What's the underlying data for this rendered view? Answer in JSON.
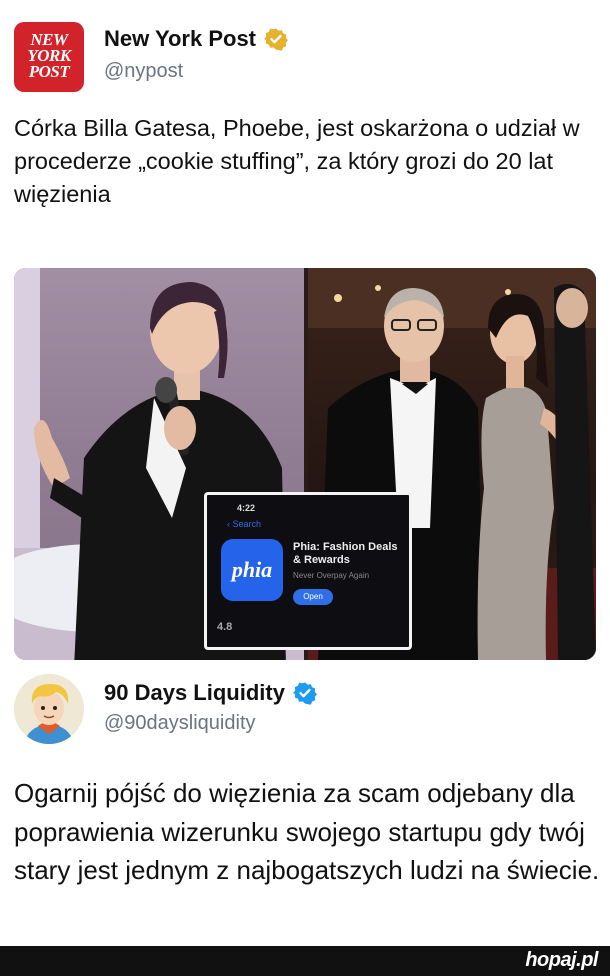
{
  "post": {
    "author_name": "New York Post",
    "author_handle": "@nypost",
    "avatar_logo": [
      "NEW",
      "YORK",
      "POST"
    ],
    "verified_badge_color": "#e6b22e",
    "text": "Córka Billa Gatesa, Phoebe, jest oskarżona o udział w procederze „cookie stuffing”, za który grozi do 20 lat więzienia",
    "image": {
      "inset_app": {
        "status_time": "4:22",
        "back_label": "Search",
        "logo_text": "phia",
        "title": "Phia: Fashion Deals & Rewards",
        "subtitle": "Never Overpay Again",
        "open_label": "Open",
        "rating": "4.8"
      }
    }
  },
  "reply": {
    "author_name": "90 Days Liquidity",
    "author_handle": "@90daysliquidity",
    "verified_badge_color": "#1d9bf0",
    "text": "Ogarnij pójść do więzienia za scam odjebany dla poprawienia wizerunku swojego startupu gdy twój stary jest jednym z najbogatszych ludzi na świecie."
  },
  "footer": {
    "brand": "hopaj.pl"
  }
}
